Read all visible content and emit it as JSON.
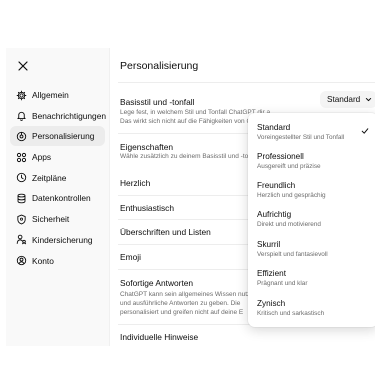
{
  "sidebar": {
    "close_icon": "close-icon",
    "items": [
      {
        "label": "Allgemein",
        "icon": "gear-icon"
      },
      {
        "label": "Benachrichtigungen",
        "icon": "bell-icon"
      },
      {
        "label": "Personalisierung",
        "icon": "personalize-icon",
        "active": true
      },
      {
        "label": "Apps",
        "icon": "apps-grid-icon"
      },
      {
        "label": "Zeitpläne",
        "icon": "clock-icon"
      },
      {
        "label": "Datenkontrollen",
        "icon": "database-icon"
      },
      {
        "label": "Sicherheit",
        "icon": "shield-icon"
      },
      {
        "label": "Kindersicherung",
        "icon": "parental-icon"
      },
      {
        "label": "Konto",
        "icon": "account-icon"
      }
    ]
  },
  "main": {
    "title": "Personalisierung",
    "base_style": {
      "label": "Basisstil und -tonfall",
      "desc_line1": "Lege fest, in welchem Stil und Tonfall ChatGPT dir antwortet.",
      "desc_line2": "Das wirkt sich nicht auf die Fähigkeiten von ChatGPT aus.",
      "selected": "Standard"
    },
    "characteristics": {
      "label": "Eigenschaften",
      "desc": "Wähle zusätzlich zu deinem Basisstil und -tonfall Anpassungen"
    },
    "traits": [
      "Herzlich",
      "Enthusiastisch",
      "Überschriften und Listen",
      "Emoji"
    ],
    "quick_answers": {
      "label": "Sofortige Antworten",
      "desc_line1": "ChatGPT kann sein allgemeines Wissen nutzen",
      "desc_line2": "und ausführliche Antworten zu geben. Die",
      "desc_line3": "personalisiert und greifen nicht auf deine E"
    },
    "custom_instructions": "Individuelle Hinweise"
  },
  "dropdown": {
    "options": [
      {
        "label": "Standard",
        "desc": "Voreingestellter Stil und Tonfall",
        "selected": true
      },
      {
        "label": "Professionell",
        "desc": "Ausgereift und präzise"
      },
      {
        "label": "Freundlich",
        "desc": "Herzlich und gesprächig"
      },
      {
        "label": "Aufrichtig",
        "desc": "Direkt und motivierend"
      },
      {
        "label": "Skurril",
        "desc": "Verspielt und fantasievoll"
      },
      {
        "label": "Effizient",
        "desc": "Prägnant und klar"
      },
      {
        "label": "Zynisch",
        "desc": "Kritisch und sarkastisch"
      }
    ],
    "check_icon": "checkmark-icon"
  }
}
